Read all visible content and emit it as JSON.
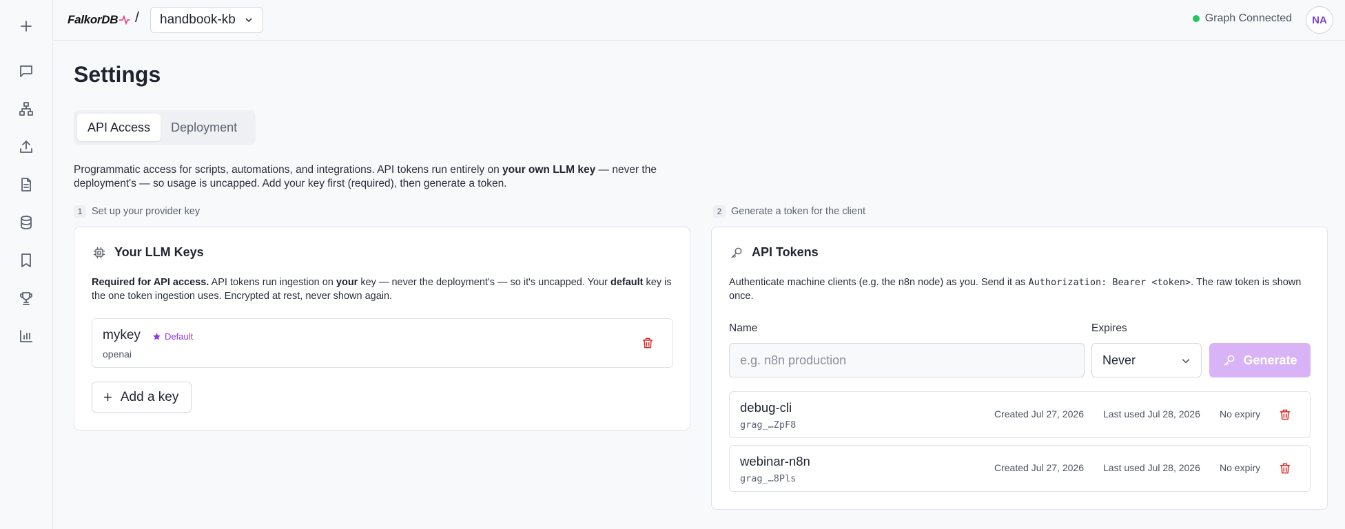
{
  "sidebar": {
    "items": [
      {
        "icon": "plus-icon",
        "label": "New"
      },
      {
        "icon": "chat-icon",
        "label": "Chat"
      },
      {
        "icon": "graph-icon",
        "label": "Graph"
      },
      {
        "icon": "upload-icon",
        "label": "Upload"
      },
      {
        "icon": "document-icon",
        "label": "Documents"
      },
      {
        "icon": "database-icon",
        "label": "Database"
      },
      {
        "icon": "bookmark-icon",
        "label": "Bookmarks"
      },
      {
        "icon": "trophy-icon",
        "label": "Leaderboard"
      },
      {
        "icon": "chart-icon",
        "label": "Analytics"
      }
    ]
  },
  "header": {
    "logo_text": "FalkorDB",
    "breadcrumb_separator": "/",
    "graph_name": "handbook-kb",
    "status_text": "Graph Connected",
    "status_color": "#22c55e",
    "avatar_initials": "NA"
  },
  "page": {
    "title": "Settings",
    "tabs": [
      {
        "label": "API Access",
        "active": true
      },
      {
        "label": "Deployment",
        "active": false
      }
    ],
    "intro": {
      "part1": "Programmatic access for scripts, automations, and integrations. API tokens run entirely on ",
      "bold": "your own LLM key",
      "part2": " — never the deployment's — so usage is uncapped. Add your key first (required), then generate a token."
    }
  },
  "steps": [
    {
      "num": "1",
      "label": "Set up your provider key"
    },
    {
      "num": "2",
      "label": "Generate a token for the client"
    }
  ],
  "llm_keys": {
    "title": "Your LLM Keys",
    "desc_bold1": "Required for API access.",
    "desc_part1": " API tokens run ingestion on ",
    "desc_bold2": "your",
    "desc_part2": " key — never the deployment's — so it's uncapped. Your ",
    "desc_bold3": "default",
    "desc_part3": " key is the one token ingestion uses. Encrypted at rest, never shown again.",
    "keys": [
      {
        "name": "mykey",
        "badge": "Default",
        "provider": "openai"
      }
    ],
    "add_label": "Add a key"
  },
  "api_tokens": {
    "title": "API Tokens",
    "desc_part1": "Authenticate machine clients (e.g. the n8n node) as you. Send it as ",
    "desc_code": "Authorization: Bearer <token>",
    "desc_part2": ". The raw token is shown once.",
    "name_label": "Name",
    "name_placeholder": "e.g. n8n production",
    "name_value": "",
    "expires_label": "Expires",
    "expires_value": "Never",
    "generate_label": "Generate",
    "accent_color": "#d8b4f6",
    "tokens": [
      {
        "name": "debug-cli",
        "hint": "grag_…ZpF8",
        "created": "Created Jul 27, 2026",
        "last_used": "Last used Jul 28, 2026",
        "expiry": "No expiry"
      },
      {
        "name": "webinar-n8n",
        "hint": "grag_…8Pls",
        "created": "Created Jul 27, 2026",
        "last_used": "Last used Jul 28, 2026",
        "expiry": "No expiry"
      }
    ]
  }
}
